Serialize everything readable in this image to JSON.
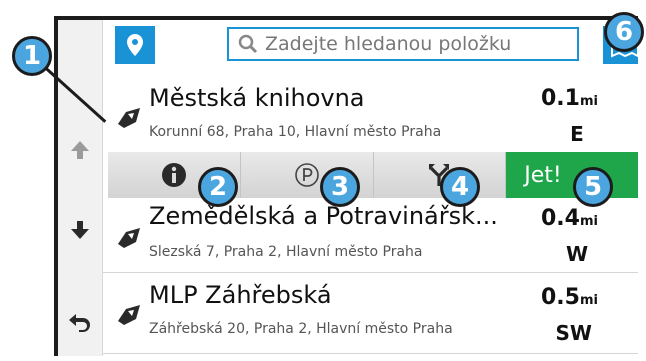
{
  "search": {
    "placeholder": "Zadejte hledanou položku"
  },
  "nav": {
    "icons": [
      "up-arrow-icon",
      "down-arrow-icon",
      "back-icon"
    ]
  },
  "results": [
    {
      "name": "Městská knihovna",
      "address": "Korunní 68, Praha 10, Hlavní město Praha",
      "distance": "0.1",
      "unit": "mi",
      "direction": "E"
    },
    {
      "name": "Zemědělská a Potravinářsk...",
      "address": "Slezská 7, Praha 2, Hlavní město Praha",
      "distance": "0.4",
      "unit": "mi",
      "direction": "W"
    },
    {
      "name": "MLP Záhřebská",
      "address": "Záhřebská 20, Praha 2, Hlavní město Praha",
      "distance": "0.5",
      "unit": "mi",
      "direction": "SW"
    }
  ],
  "actions": {
    "go_label": "Jet!"
  },
  "callouts": [
    "1",
    "2",
    "3",
    "4",
    "5",
    "6"
  ],
  "colors": {
    "accent": "#1a93d6",
    "go": "#1fa64a",
    "callout_fill": "#4ba6e0"
  }
}
